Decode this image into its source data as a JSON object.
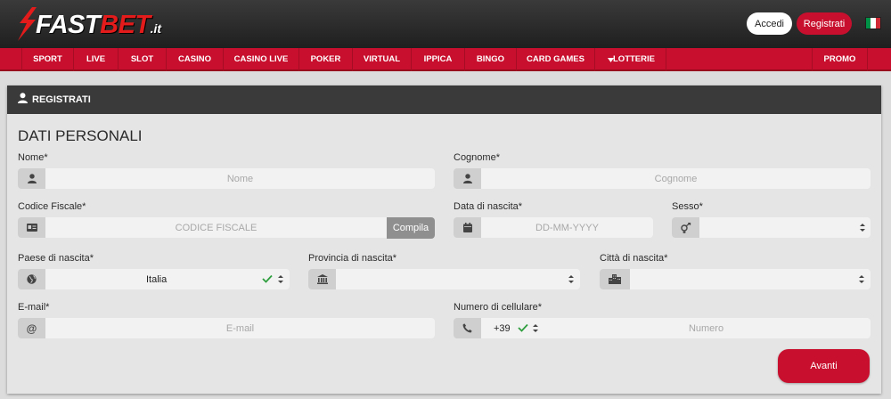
{
  "brand": {
    "name_a": "FAST",
    "name_b": "BET",
    "tld": ".it"
  },
  "header": {
    "login_label": "Accedi",
    "register_label": "Registrati",
    "flag_colors": [
      "#009246",
      "#ffffff",
      "#ce2b37"
    ]
  },
  "nav": {
    "items": [
      "SPORT",
      "LIVE",
      "SLOT",
      "CASINO",
      "CASINO LIVE",
      "POKER",
      "VIRTUAL",
      "IPPICA",
      "BINGO",
      "CARD GAMES",
      "LOTTERIE"
    ],
    "promo": "PROMO"
  },
  "panel": {
    "title": "REGISTRATI"
  },
  "form": {
    "section_title": "DATI PERSONALI",
    "nome": {
      "label": "Nome*",
      "placeholder": "Nome"
    },
    "cognome": {
      "label": "Cognome*",
      "placeholder": "Cognome"
    },
    "codice_fiscale": {
      "label": "Codice Fiscale*",
      "placeholder": "CODICE FISCALE",
      "button": "Compila"
    },
    "data_nascita": {
      "label": "Data di nascita*",
      "placeholder": "DD-MM-YYYY"
    },
    "sesso": {
      "label": "Sesso*"
    },
    "paese_nascita": {
      "label": "Paese di nascita*",
      "value": "Italia"
    },
    "provincia_nascita": {
      "label": "Provincia di nascita*"
    },
    "citta_nascita": {
      "label": "Città di nascita*"
    },
    "email": {
      "label": "E-mail*",
      "placeholder": "E-mail"
    },
    "cellulare": {
      "label": "Numero di cellulare*",
      "prefix": "+39",
      "placeholder": "Numero"
    },
    "submit": "Avanti"
  },
  "colors": {
    "brand_red": "#c8102e",
    "check_green": "#2e9e3e"
  }
}
